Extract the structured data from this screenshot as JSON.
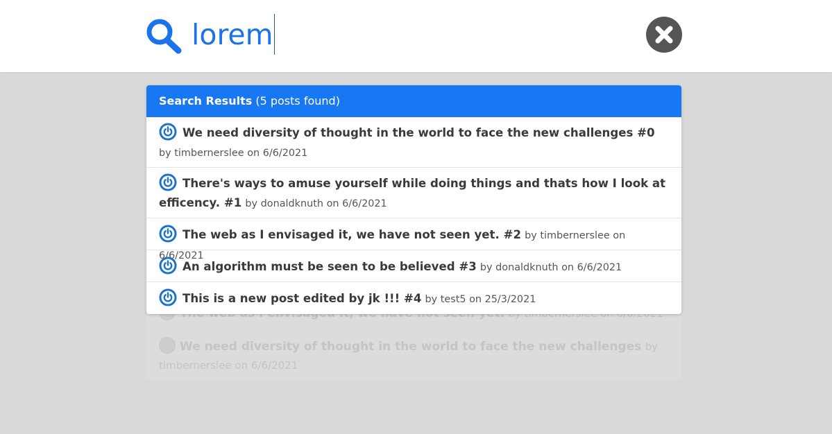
{
  "search": {
    "query": "lorem"
  },
  "results": {
    "title": "Search Results",
    "count_text": "(5 posts found)",
    "items": [
      {
        "title": "We need diversity of thought in the world to face the new challenges #0",
        "meta": "by timbernerslee on 6/6/2021"
      },
      {
        "title": "There's ways to amuse yourself while doing things and thats how I look at efficency. #1",
        "meta": "by donaldknuth on 6/6/2021"
      },
      {
        "title": "The web as I envisaged it, we have not seen yet. #2",
        "meta": "by timbernerslee on 6/6/2021"
      },
      {
        "title": "An algorithm must be seen to be believed #3",
        "meta": "by donaldknuth on 6/6/2021"
      },
      {
        "title": "This is a new post edited by jk !!! #4",
        "meta": "by test5 on 25/3/2021"
      }
    ]
  },
  "background_posts": [
    {
      "title": "The web as I envisaged it, we have not seen yet.",
      "meta": "by timbernerslee on 6/6/2021"
    },
    {
      "title": "We need diversity of thought in the world to face the new challenges",
      "meta": "by timbernerslee on 6/6/2021"
    }
  ],
  "colors": {
    "accent": "#1877f2",
    "query_text": "#1a73e8",
    "overlay": "#d9d9d9",
    "close_button": "#555555",
    "result_icon": "#1a73c8"
  },
  "icons": {
    "search": "search-icon",
    "close": "close-icon",
    "result": "power-icon"
  }
}
